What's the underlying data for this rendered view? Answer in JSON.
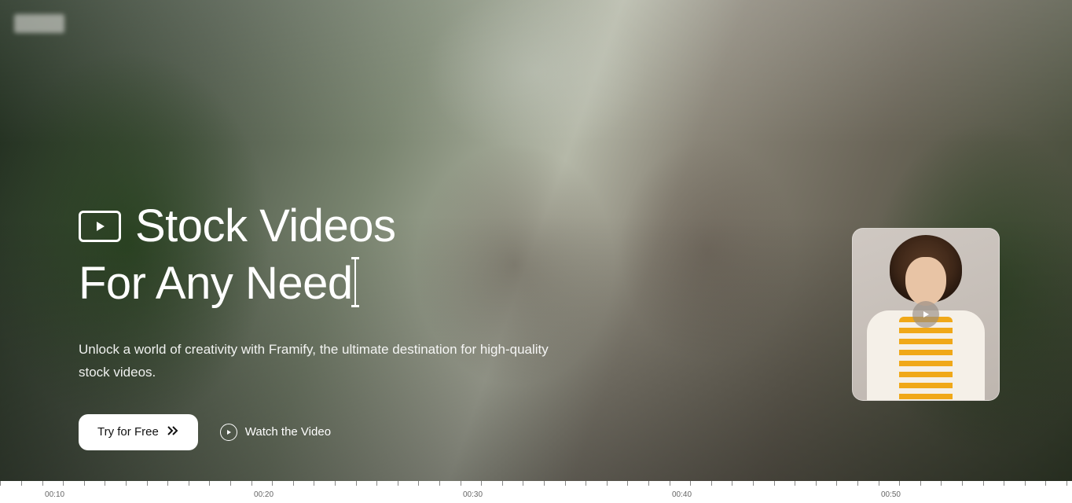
{
  "hero": {
    "headline_line1": "Stock Videos",
    "headline_line2": "For Any Need",
    "subtext": "Unlock a world of creativity with Framify, the ultimate destination for high-quality stock videos.",
    "primary_button": "Try for Free",
    "secondary_button": "Watch the Video"
  },
  "icons": {
    "video_frame": "video-frame-icon",
    "chevrons": "chevrons-right-icon",
    "play_circle": "play-circle-icon",
    "thumb_play": "play-icon"
  },
  "timeline": {
    "labels": [
      "00:10",
      "00:20",
      "00:30",
      "00:40",
      "00:50"
    ],
    "major_positions_pct": [
      5.1,
      24.6,
      44.1,
      63.6,
      83.1
    ],
    "ticks_per_segment": 10
  }
}
